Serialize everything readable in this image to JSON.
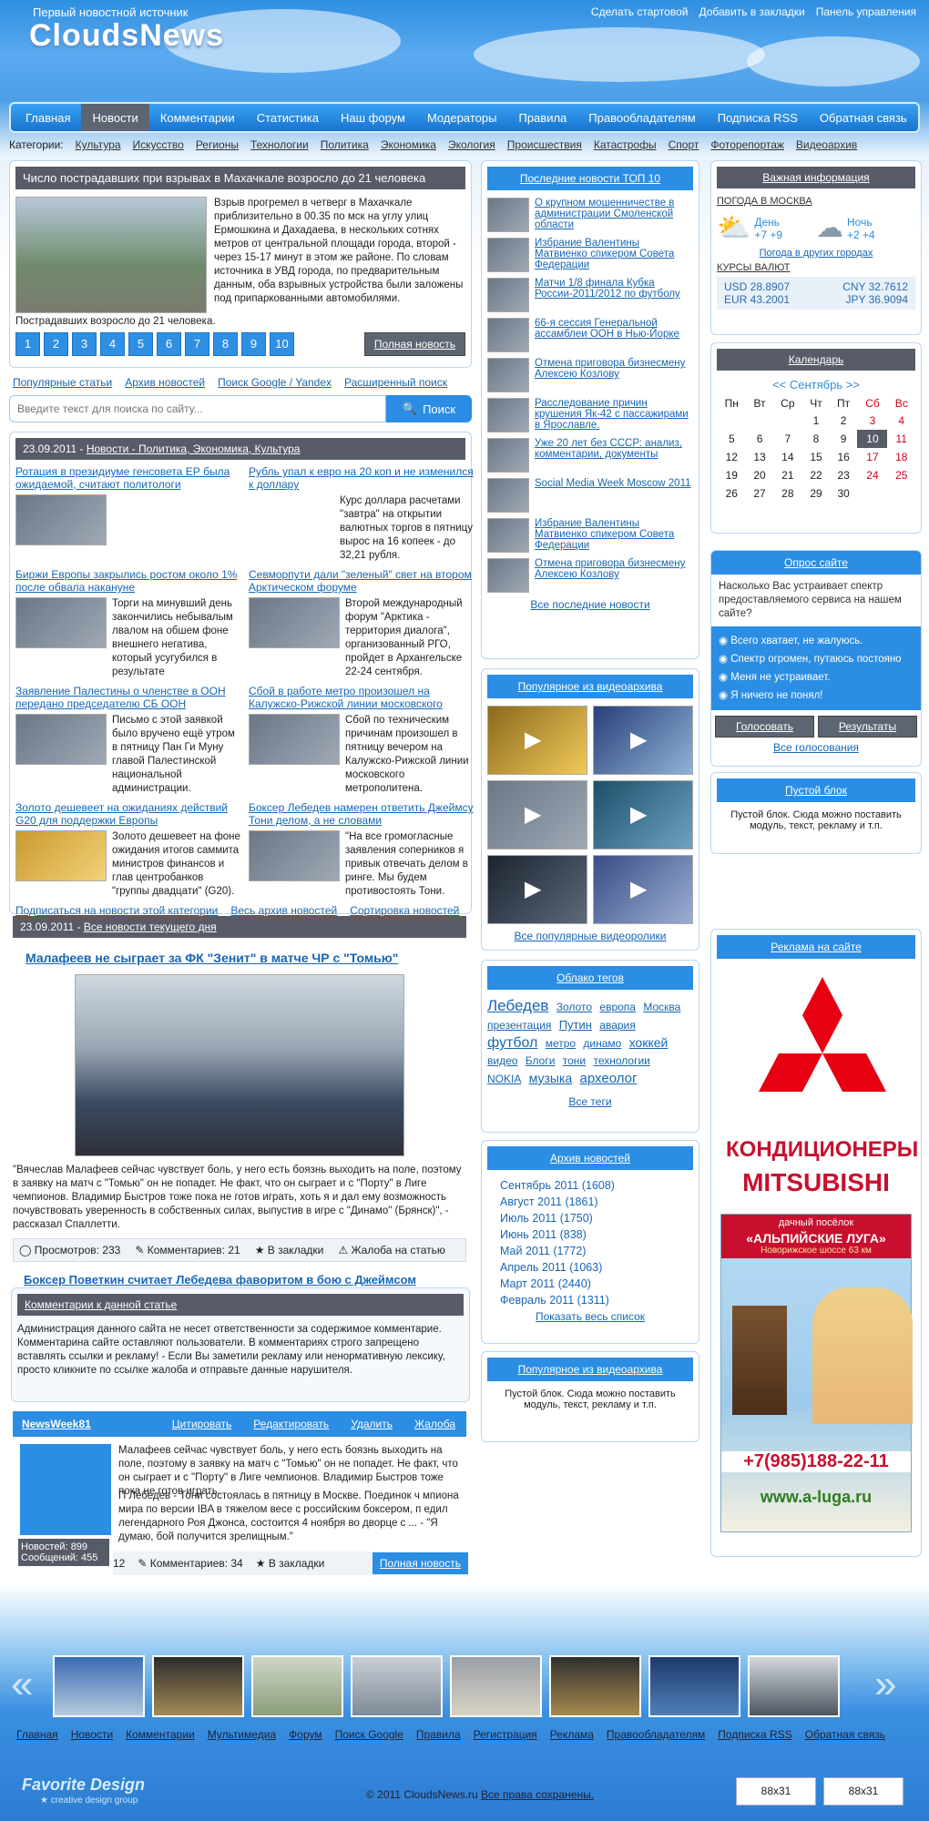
{
  "header": {
    "tagline": "Первый новостной источник",
    "logo": "CloudsNews",
    "links": [
      "Сделать стартовой",
      "Добавить в закладки",
      "Панель управления"
    ]
  },
  "nav": [
    "Главная",
    "Новости",
    "Комментарии",
    "Статистика",
    "Наш форум",
    "Модераторы",
    "Правила",
    "Правообладателям",
    "Подписка RSS",
    "Обратная связь"
  ],
  "categories_label": "Категории:",
  "categories": [
    "Культура",
    "Искусство",
    "Регионы",
    "Технологии",
    "Политика",
    "Экономика",
    "Экология",
    "Происшествия",
    "Катастрофы",
    "Спорт",
    "Фоторепортаж",
    "Видеоархив"
  ],
  "slider": {
    "title": "Число пострадавших при взрывах в Махачкале возросло до 21 человека",
    "text": "Взрыв прогремел в четверг в Махачкале приблизительно в 00.35 по мск на углу улиц Ермошкина и Дахадаева, в нескольких сотнях метров от центральной площади города, второй - через 15-17 минут в этом же районе. По словам источника в УВД города, по предварительным данным, оба взрывных устройства были заложены под припаркованными автомобилями.",
    "caption": "Пострадавших возросло до 21 человека.",
    "pages": [
      "1",
      "2",
      "3",
      "4",
      "5",
      "6",
      "7",
      "8",
      "9",
      "10"
    ],
    "full_btn": "Полная новость"
  },
  "search": {
    "links": [
      "Популярные статьи",
      "Архив новостей",
      "Поиск Google / Yandex",
      "Расширенный поиск"
    ],
    "placeholder": "Введите текст для поиска по сайту...",
    "button": "Поиск"
  },
  "catnews": {
    "date": "23.09.2011 -",
    "header": "Новости - Политика, Экономика, Культура",
    "items": [
      {
        "title": "Ротация в президиуме генсовета ЕР была ожидаемой, считают политологи",
        "text": ""
      },
      {
        "title": "Рубль упал к евро на 20 коп и не изменился к доллару",
        "text": "Курс доллара расчетами \"завтра\" на открытии валютных торгов в пятницу вырос на 16 копеек - до 32,21 рубля."
      },
      {
        "title": "Биржи Европы закрылись ростом около 1% после обвала накануне",
        "text": "Торги на минувший день закончились небывалым лвалом на обшем фоне внешнего негатива, который усугубился в результате"
      },
      {
        "title": "Севморпути дали \"зеленый\" свет на втором Арктическом форуме",
        "text": "Второй международный форум \"Арктика - территория диалога\", организованный РГО, пройдет в Архангельске 22-24 сентября."
      },
      {
        "title": "Заявление Палестины о членстве в ООН передано председателю СБ ООН",
        "text": "Письмо с этой заявкой было вручено ещё утром в пятницу Пан Ги Муну главой Палестинской национальной администрации."
      },
      {
        "title": "Сбой в работе метро произошел на Калужско-Рижской линии московского",
        "text": "Сбой по техническим причинам произошел в пятницу вечером на Калужско-Рижской линии московского метрополитена."
      },
      {
        "title": "Золото дешевеет на ожиданиях действий G20 для поддержки Европы",
        "text": "Золото дешевеет на фоне ожидания итогов саммита министров финансов и глав центробанков \"группы двадцати\" (G20)."
      },
      {
        "title": "Боксер Лебедев намерен ответить Джеймсу Тони делом, а не словами",
        "text": "\"На все громогласные заявления соперников я привык отвечать делом в ринге. Мы будем противостоять Тони."
      }
    ],
    "footer": [
      "Подписаться на новости этой категории",
      "Весь архив новостей",
      "Сортировка новостей"
    ]
  },
  "today": {
    "date": "23.09.2011 -",
    "link": "Все новости текущего дня",
    "title": "Малафеев не сыграет за ФК \"Зенит\" в матче ЧР с \"Томью\"",
    "text": "\"Вячеслав Малафеев сейчас чувствует боль, у него есть боязнь выходить на поле, поэтому в заявку на матч с \"Томью\" он не попадет. Не факт, что он сыграет и с \"Порту\" в Лиге чемпионов. Владимир Быстров тоже пока не готов играть, хоть я и дал ему возможность почувствовать уверенность в собственных силах, выпустив в игре с \"Динамо\" (Брянск)\", - рассказал Спаллетти.",
    "views": "Просмотров: 233",
    "comments": "Комментариев: 21",
    "bookmark": "В закладки",
    "complaint": "Жалоба на статью",
    "next": "Боксер Поветкин считает Лебедева фаворитом в бою с Джеймсом"
  },
  "comments": {
    "title": "Комментарии к данной статье",
    "notice": "Администрация данного сайта не несет ответственности за содержимое комментарие. Комментарина сайте оставляют пользователи. В комментариях строго запрещено вставлять ссылки и рекламу! - Если Вы заметили рекламу или ненормативную лексику, просто кликните по ссылке жалоба и отправьте данные нарушителя.",
    "user": "NewsWeek81",
    "actions": [
      "Цитировать",
      "Редактировать",
      "Удалить",
      "Жалоба"
    ],
    "body": "Малафеев сейчас чувствует боль, у него есть боязнь выходить на поле, поэтому в заявку на матч с \"Томью\" он не попадет. Не факт, что он сыграет и с \"Порту\" в Лиге чемпионов. Владимир Быстров тоже пока не готов играть.",
    "body2": "П Лебедев - Тони состоялась в пятницу в Москве. Поединок ч мпиона мира по версии IBA в тяжелом весе с российским боксером, п едил легендарного Роя Джонса, состоится 4 ноября во дворце с ... - \"Я думаю, бой получится зрелищным.\"",
    "news": "Новостей: 899",
    "msgs": "Сообщений: 455",
    "views": "12",
    "comm": "Комментариев: 34",
    "bm": "В закладки",
    "full": "Полная новость"
  },
  "top10": {
    "title": "Последние новости ТОП 10",
    "items": [
      "О крупном мошенничестве в администрации Смоленской области",
      "Избрание Валентины Матвиенко спикером Совета Федерации",
      "Матчи 1/8 финала Кубка России-2011/2012 по футболу",
      "66-я сессия Генеральной ассамблеи ООН в Нью-Йорке",
      "Отмена приговора бизнесмену Алексею Козлову",
      "Расследование причин крушения Як-42 с пассажирами в Ярославле.",
      "Уже 20 лет без СССР: анализ, комментарии, документы",
      "Social Media Week Moscow 2011",
      "Избрание Валентины Матвиенко спикером Совета Федерации",
      "Отмена приговора бизнесмену Алексею Козлову"
    ],
    "all": "Все последние новости"
  },
  "videos": {
    "title": "Популярное из видеоархива",
    "all": "Все популярные видеоролики"
  },
  "tags": {
    "title": "Облако тегов",
    "items": [
      "Лебедев",
      "Золото",
      "европа",
      "Москва",
      "презентация",
      "Путин",
      "авария",
      "футбол",
      "метро",
      "динамо",
      "хоккей",
      "видео",
      "Блоги",
      "тони",
      "технологии",
      "NOKIA",
      "музыка",
      "археолог"
    ],
    "all": "Все теги"
  },
  "archive": {
    "title": "Архив новостей",
    "items": [
      "Сентябрь 2011 (1608)",
      "Август 2011 (1861)",
      "Июль 2011 (1750)",
      "Июнь 2011 (838)",
      "Май 2011 (1772)",
      "Апрель 2011 (1063)",
      "Март 2011 (2440)",
      "Февраль 2011 (1311)"
    ],
    "all": "Показать весь список"
  },
  "videoarch2": {
    "title": "Популярное из видеоархива",
    "text": "Пустой блок. Сюда можно поставить модуль, текст, рекламу и т.п."
  },
  "info": {
    "title": "Важная информация",
    "weather_title": "ПОГОДА В МОСКВА",
    "day": "День",
    "day_t": "+7   +9",
    "night": "Ночь",
    "night_t": "+2   +4",
    "other": "Погода в других городах",
    "rates_title": "КУРСЫ ВАЛЮТ",
    "usd": "USD 28.8907",
    "cny": "CNY 32.7612",
    "eur": "EUR 43.2001",
    "jpy": "JPY 36.9094"
  },
  "calendar": {
    "title": "Календарь",
    "month": "<< Сентябрь >>",
    "days": [
      "Пн",
      "Вт",
      "Ср",
      "Чт",
      "Пт",
      "Сб",
      "Вс"
    ],
    "rows": [
      [
        "",
        "",
        "",
        "1",
        "2",
        "3",
        "4"
      ],
      [
        "5",
        "6",
        "7",
        "8",
        "9",
        "10",
        "11"
      ],
      [
        "12",
        "13",
        "14",
        "15",
        "16",
        "17",
        "18"
      ],
      [
        "19",
        "20",
        "21",
        "22",
        "23",
        "24",
        "25"
      ],
      [
        "26",
        "27",
        "28",
        "29",
        "30",
        "",
        ""
      ]
    ]
  },
  "poll": {
    "title": "Опрос сайте",
    "question": "Насколько Вас устраивает спектр предоставляемого сервиса на нашем сайте?",
    "options": [
      "Всего хватает, не жалуюсь.",
      "Спектр огромен, путаюсь постояно",
      "Меня не устраивает.",
      "Я ничего не понял!"
    ],
    "vote": "Голосовать",
    "results": "Результаты",
    "all": "Все голосования"
  },
  "empty": {
    "title": "Пустой блок",
    "text": "Пустой блок. Сюда можно поставить модуль, текст, рекламу и т.п."
  },
  "ads": {
    "title": "Реклама на сайте",
    "ad1": "КОНДИЦИОНЕРЫ",
    "ad1b": "MITSUBISHI",
    "ad2a": "дачный посёлок",
    "ad2b": "«АЛЬПИЙСКИЕ ЛУГА»",
    "ad2c": "Новорижское шоссе 63 км",
    "phone": "+7(985)188-22-11",
    "site": "www.a-luga.ru"
  },
  "footer": {
    "links": [
      "Главная",
      "Новости",
      "Комментарии",
      "Мультимедиа",
      "Форум",
      "Поиск Google",
      "Правила",
      "Регистрация",
      "Реклама",
      "Правообладателям",
      "Подписка RSS",
      "Обратная связь"
    ],
    "brand": "Favorite Design",
    "brand_sub": "★ creative design group",
    "copy": "© 2011 CloudsNews.ru",
    "rights": "Все права сохранены.",
    "b1": "88x31",
    "b2": "88x31"
  }
}
